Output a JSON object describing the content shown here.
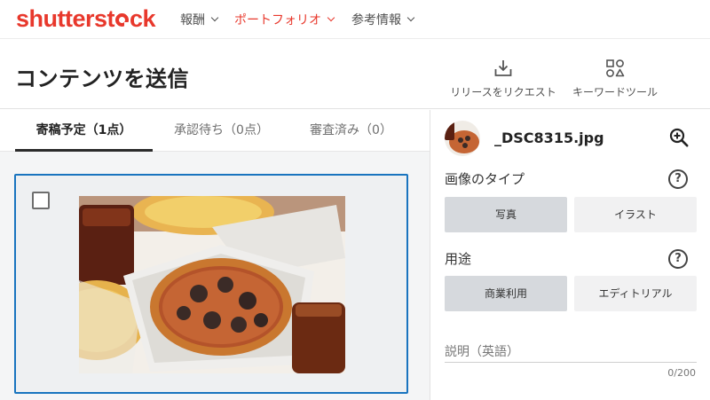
{
  "brand": {
    "logo_text_left": "shutterst",
    "logo_text_right": "ck"
  },
  "nav": {
    "items": [
      {
        "label": "報酬"
      },
      {
        "label": "ポートフォリオ"
      },
      {
        "label": "参考情報"
      }
    ],
    "active_index": 1
  },
  "header": {
    "title": "コンテンツを送信",
    "actions": {
      "release_request": "リリースをリクエスト",
      "keyword_tool": "キーワードツール"
    }
  },
  "tabs": [
    {
      "label": "寄稿予定（1点）",
      "active": true
    },
    {
      "label": "承認待ち（0点）",
      "active": false
    },
    {
      "label": "審査済み（0）",
      "active": false
    }
  ],
  "card": {
    "checked": false
  },
  "panel": {
    "file_name": "_DSC8315.jpg",
    "image_type": {
      "label": "画像のタイプ",
      "help": "?",
      "options": [
        "写真",
        "イラスト"
      ],
      "selected": "写真"
    },
    "usage": {
      "label": "用途",
      "help": "?",
      "options": [
        "商業利用",
        "エディトリアル"
      ],
      "selected": "商業利用"
    },
    "description": {
      "label": "説明（英語）",
      "counter": "0/200"
    }
  },
  "colors": {
    "brand_red": "#e8382c",
    "selection_blue": "#1974bf",
    "selected_option_bg": "#d6d9dd"
  },
  "icons": [
    "download-tray-icon",
    "shapes-icon",
    "zoom-in-icon",
    "help-icon",
    "checkbox-icon",
    "chevron-down-icon"
  ]
}
